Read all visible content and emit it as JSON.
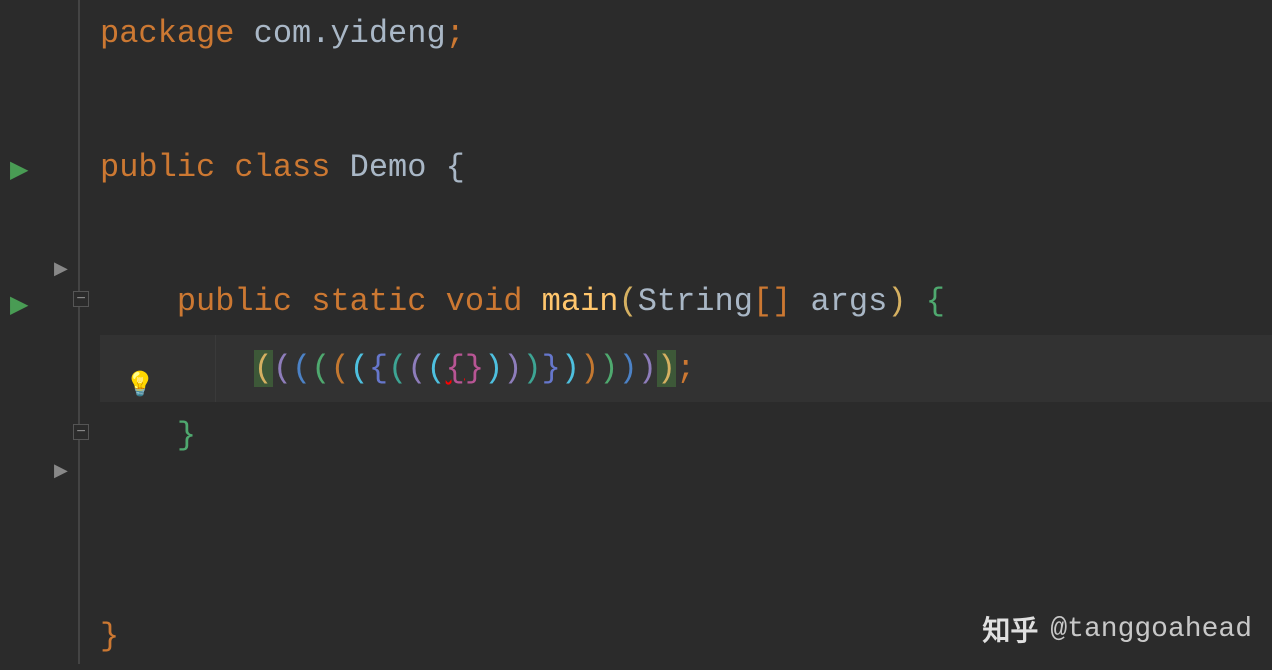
{
  "code": {
    "line1": {
      "package_kw": "package",
      "package_name": "com.yideng",
      "semi": ";"
    },
    "line3": {
      "public_kw": "public",
      "class_kw": "class",
      "class_name": "Demo",
      "brace": "{"
    },
    "line5": {
      "public_kw": "public",
      "static_kw": "static",
      "void_kw": "void",
      "method_name": "main",
      "lparen": "(",
      "param_type": "String",
      "brackets": "[]",
      "param_name": "args",
      "rparen": ")",
      "brace": "{"
    },
    "line6": {
      "brackets": {
        "b1": "(",
        "b2": "(",
        "b3": "(",
        "b4": "(",
        "b5": "(",
        "b6": "(",
        "b7": "{",
        "b8": "(",
        "b9": "(",
        "b10": "(",
        "b11": "{",
        "b12": "}",
        "b13": ")",
        "b14": ")",
        "b15": ")",
        "b16": "}",
        "b17": ")",
        "b18": ")",
        "b19": ")",
        "b20": ")",
        "b21": ")",
        "b22": ")"
      },
      "semi": ";"
    },
    "line7": {
      "brace": "}"
    },
    "line10": {
      "brace": "}"
    }
  },
  "watermark": {
    "platform": "知乎",
    "username": "@tanggoahead"
  }
}
